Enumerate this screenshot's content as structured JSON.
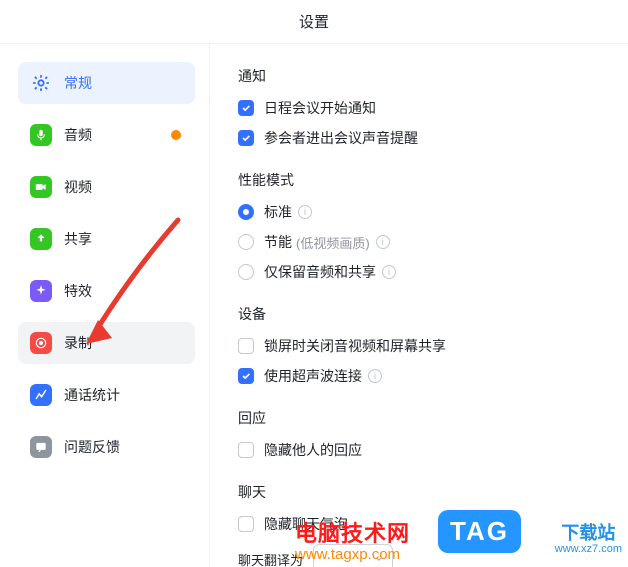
{
  "title": "设置",
  "sidebar": {
    "items": [
      {
        "label": "常规"
      },
      {
        "label": "音频"
      },
      {
        "label": "视频"
      },
      {
        "label": "共享"
      },
      {
        "label": "特效"
      },
      {
        "label": "录制"
      },
      {
        "label": "通话统计"
      },
      {
        "label": "问题反馈"
      }
    ]
  },
  "sections": {
    "notify": {
      "title": "通知",
      "calendar": "日程会议开始通知",
      "joinSound": "参会者进出会议声音提醒"
    },
    "perf": {
      "title": "性能模式",
      "standard": "标准",
      "eco": "节能",
      "ecoSub": "(低视频画质)",
      "audioOnly": "仅保留音频和共享"
    },
    "device": {
      "title": "设备",
      "lock": "锁屏时关闭音视频和屏幕共享",
      "ultrasonic": "使用超声波连接"
    },
    "reaction": {
      "title": "回应",
      "hide": "隐藏他人的回应"
    },
    "chat": {
      "title": "聊天",
      "hide": "隐藏聊天气泡",
      "translateLabel": "聊天翻译为"
    }
  },
  "watermarks": {
    "siteName": "电脑技术网",
    "siteUrl": "www.tagxp.com",
    "tag": "TAG",
    "xz7a": "下载站",
    "xz7b": "www.xz7.com"
  }
}
